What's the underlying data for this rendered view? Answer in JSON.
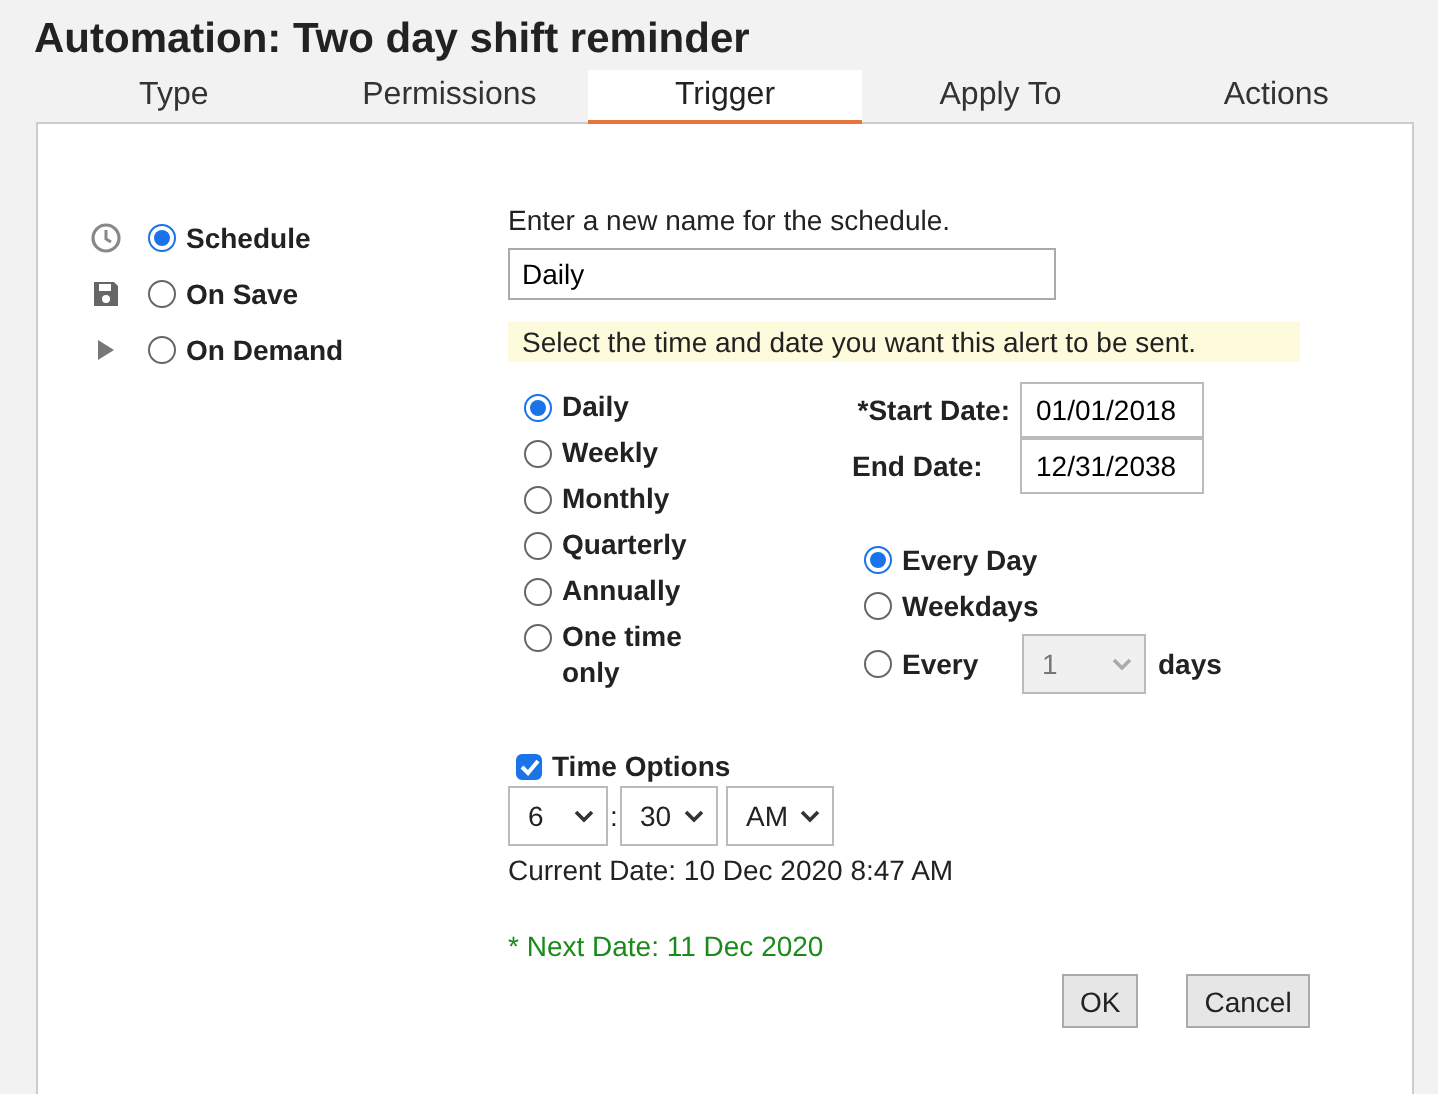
{
  "title": "Automation: Two day shift reminder",
  "tabs": [
    {
      "label": "Type",
      "selected": false
    },
    {
      "label": "Permissions",
      "selected": false
    },
    {
      "label": "Trigger",
      "selected": true
    },
    {
      "label": "Apply To",
      "selected": false
    },
    {
      "label": "Actions",
      "selected": false
    }
  ],
  "triggers": [
    {
      "label": "Schedule",
      "kind": "clock",
      "selected": true
    },
    {
      "label": "On Save",
      "kind": "save",
      "selected": false
    },
    {
      "label": "On Demand",
      "kind": "play",
      "selected": false
    }
  ],
  "schedule_name": {
    "label": "Enter a new name for the schedule.",
    "value": "Daily"
  },
  "hint": "Select the time and date you want this alert to be sent.",
  "frequencies": [
    {
      "label": "Daily",
      "selected": true
    },
    {
      "label": "Weekly",
      "selected": false
    },
    {
      "label": "Monthly",
      "selected": false
    },
    {
      "label": "Quarterly",
      "selected": false
    },
    {
      "label": "Annually",
      "selected": false
    },
    {
      "label": "One time only",
      "selected": false
    }
  ],
  "start_date": {
    "label": "*Start Date:",
    "value": "01/01/2018"
  },
  "end_date": {
    "label": "End Date:",
    "value": "12/31/2038"
  },
  "repeat": [
    {
      "label": "Every Day",
      "selected": true
    },
    {
      "label": "Weekdays",
      "selected": false
    },
    {
      "label": "Every",
      "selected": false
    }
  ],
  "interval": {
    "value": "1",
    "disabled": true,
    "suffix": "days"
  },
  "time_options": {
    "label": "Time Options",
    "checked": true,
    "hour": "6",
    "separator": ":",
    "minute": "30",
    "period": "AM"
  },
  "current_date": "Current Date: 10 Dec 2020 8:47 AM",
  "next_date": "* Next Date: 11 Dec 2020",
  "buttons": [
    "OK",
    "Cancel"
  ]
}
